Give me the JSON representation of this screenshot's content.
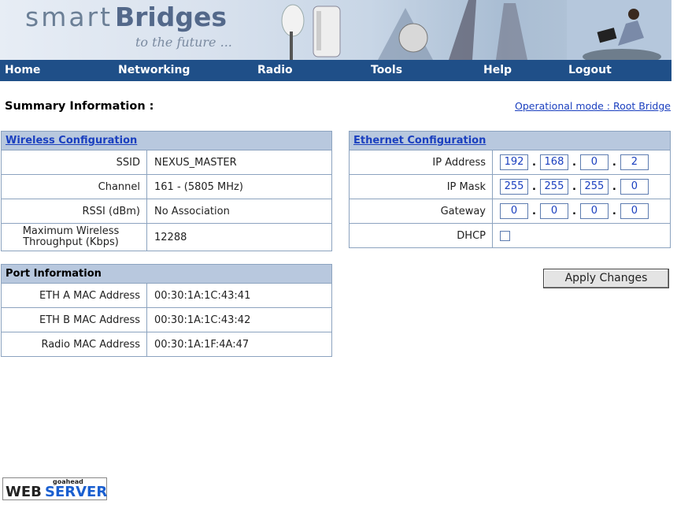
{
  "banner": {
    "brand_light": "smart",
    "brand_bold": "Bridges",
    "tagline": "to the future ..."
  },
  "nav": {
    "items": [
      "Home",
      "Networking",
      "Radio",
      "Tools",
      "Help",
      "Logout"
    ]
  },
  "summary_title": "Summary Information :",
  "operational_mode": "Operational mode : Root Bridge",
  "wireless": {
    "header": "Wireless Configuration",
    "rows": [
      {
        "label": "SSID",
        "value": "NEXUS_MASTER"
      },
      {
        "label": "Channel",
        "value": "161 - (5805 MHz)"
      },
      {
        "label": "RSSI (dBm)",
        "value": "No Association"
      },
      {
        "label_line1": "Maximum Wireless",
        "label_line2": "Throughput (Kbps)",
        "value": "12288"
      }
    ]
  },
  "port": {
    "header": "Port Information",
    "rows": [
      {
        "label": "ETH A MAC Address",
        "value": "00:30:1A:1C:43:41"
      },
      {
        "label": "ETH B MAC Address",
        "value": "00:30:1A:1C:43:42"
      },
      {
        "label": "Radio MAC Address",
        "value": "00:30:1A:1F:4A:47"
      }
    ]
  },
  "ethernet": {
    "header": "Ethernet Configuration",
    "ip_address": {
      "label": "IP Address",
      "octets": [
        "192",
        "168",
        "0",
        "2"
      ]
    },
    "ip_mask": {
      "label": "IP Mask",
      "octets": [
        "255",
        "255",
        "255",
        "0"
      ]
    },
    "gateway": {
      "label": "Gateway",
      "octets": [
        "0",
        "0",
        "0",
        "0"
      ]
    },
    "dhcp": {
      "label": "DHCP",
      "checked": false
    }
  },
  "apply_button": "Apply Changes",
  "footer_badge": {
    "small": "goahead",
    "web": "WEB",
    "server": "SERVER"
  },
  "colors": {
    "nav_bg": "#1f4f88",
    "header_bg": "#b8c8de",
    "link": "#1a3fbf",
    "border": "#8ca3bf"
  }
}
